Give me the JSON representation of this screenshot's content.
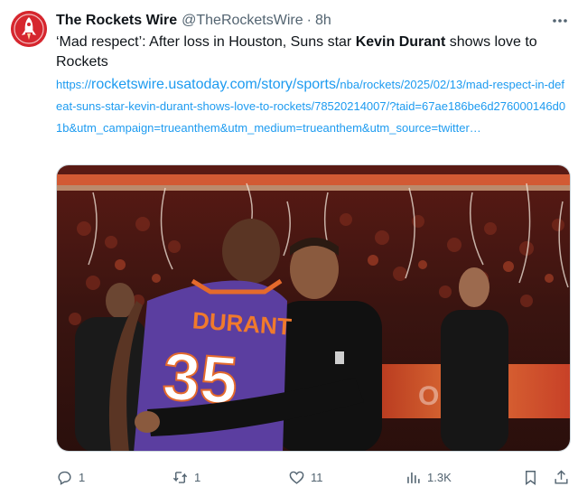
{
  "tweet": {
    "author_name": "The Rockets Wire",
    "handle": "@TheRocketsWire",
    "separator": "·",
    "time": "8h",
    "text_before": "‘Mad respect’: After loss in Houston, Suns star ",
    "text_bold": "Kevin Durant",
    "text_after": " shows love to Rockets",
    "link_prefix": "https://",
    "link_domain": "rocketswire.usatoday.com/story/sports/",
    "link_rest": "nba/rockets/2025/02/13/mad-respect-in-defeat-suns-star-kevin-durant-shows-love-to-rockets/78520214007/?taid=67ae186be6d276000146d01b&utm_campaign=trueanthem&utm_medium=trueanthem&utm_source=twitter…",
    "image": {
      "jersey_name": "DURANT",
      "jersey_number": "35",
      "icon": "photo-suns-rockets-hug"
    }
  },
  "actions": {
    "reply_count": "1",
    "retweet_count": "1",
    "like_count": "11",
    "view_count": "1.3K"
  },
  "icons": {
    "avatar": "rockets-wire-logo-icon",
    "more": "more-dots-icon",
    "reply": "reply-icon",
    "retweet": "retweet-icon",
    "like": "heart-icon",
    "views": "views-chart-icon",
    "bookmark": "bookmark-icon",
    "share": "share-icon"
  },
  "colors": {
    "link": "#1d9bf0",
    "secondary": "#536471",
    "avatar": "#d6262e",
    "suns_purple": "#5b3ea0"
  }
}
